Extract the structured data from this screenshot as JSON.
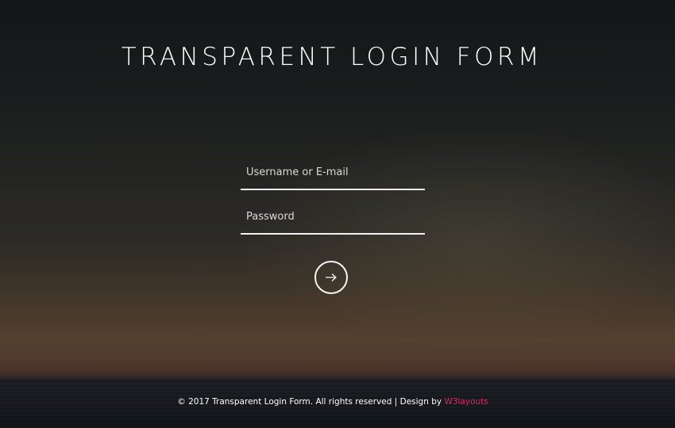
{
  "page": {
    "title": "TRANSPARENT LOGIN FORM"
  },
  "form": {
    "username_placeholder": "Username or E-mail",
    "password_placeholder": "Password",
    "submit_icon": "arrow-right-icon"
  },
  "footer": {
    "copyright": "© 2017 Transparent Login Form. All rights reserved | Design by ",
    "link_text": "W3layouts"
  },
  "colors": {
    "accent_link": "#e0255f",
    "text": "#ffffff"
  }
}
